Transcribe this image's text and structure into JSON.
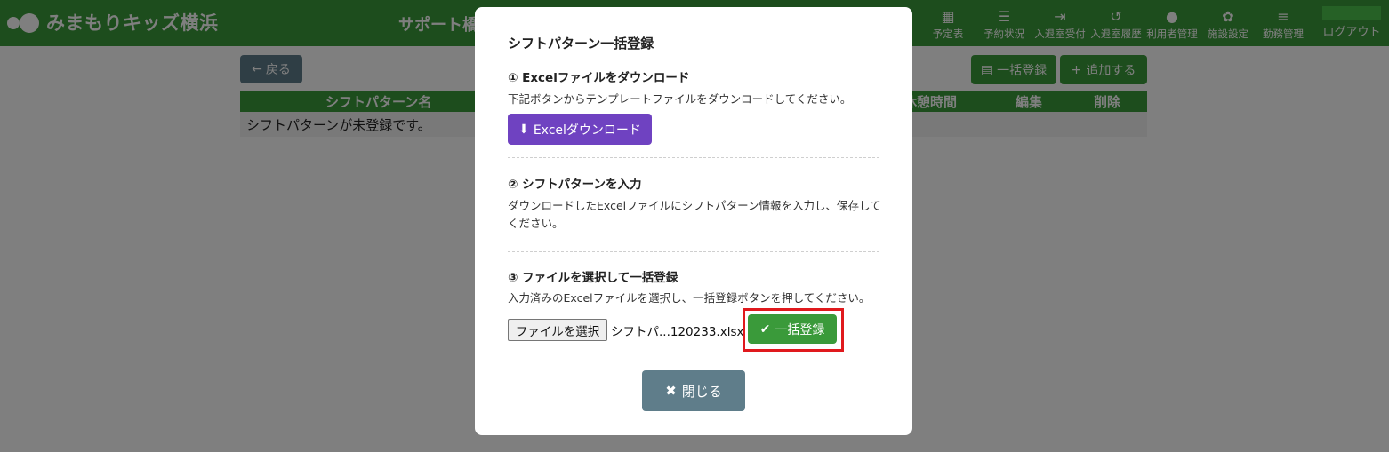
{
  "header": {
    "logo_text": "みまもりキッズ横浜",
    "title": "サポート橋",
    "nav": [
      {
        "label": "予定表",
        "icon": "calendar-icon",
        "glyph": "▦"
      },
      {
        "label": "予約状況",
        "icon": "list-icon",
        "glyph": "☰"
      },
      {
        "label": "入退室受付",
        "icon": "sign-in-icon",
        "glyph": "⇥"
      },
      {
        "label": "入退室履歴",
        "icon": "history-icon",
        "glyph": "↺"
      },
      {
        "label": "利用者管理",
        "icon": "user-edit-icon",
        "glyph": "●"
      },
      {
        "label": "施設設定",
        "icon": "gear-icon",
        "glyph": "✿"
      },
      {
        "label": "勤務管理",
        "icon": "server-icon",
        "glyph": "≡"
      }
    ],
    "logout_label": "ログアウト"
  },
  "page": {
    "back_label": "戻る",
    "bulk_label": "一括登録",
    "add_label": "追加する",
    "table_headers": [
      "シフトパターン名",
      "休憩時間",
      "編集",
      "削除"
    ],
    "empty_message": "シフトパターンが未登録です。"
  },
  "modal": {
    "title": "シフトパターン一括登録",
    "step1_title": "① Excelファイルをダウンロード",
    "step1_text": "下記ボタンからテンプレートファイルをダウンロードしてください。",
    "download_label": "Excelダウンロード",
    "step2_title": "② シフトパターンを入力",
    "step2_text": "ダウンロードしたExcelファイルにシフトパターン情報を入力し、保存してください。",
    "step3_title": "③ ファイルを選択して一括登録",
    "step3_text": "入力済みのExcelファイルを選択し、一括登録ボタンを押してください。",
    "file_button_label": "ファイルを選択",
    "file_name": "シフトパ...120233.xlsx",
    "register_label": "一括登録",
    "close_label": "閉じる"
  },
  "colors": {
    "header_green": "#3a9a3a",
    "download_purple": "#6f42c1",
    "button_slate": "#5f7d8a",
    "highlight_red": "#e0191d"
  }
}
